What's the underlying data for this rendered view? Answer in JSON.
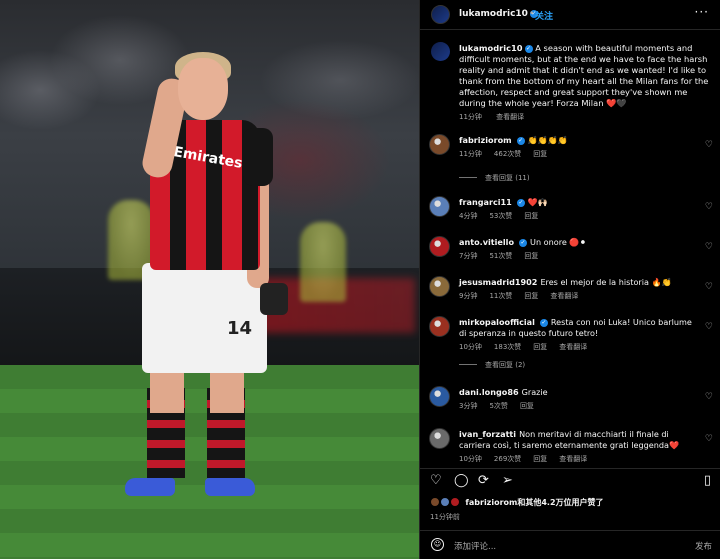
{
  "header": {
    "username": "lukamodric10",
    "separator": "•",
    "follow_label": "关注",
    "more_label": "···"
  },
  "caption": {
    "username": "lukamodric10",
    "text": "A season with beautiful moments and difficult moments, but at the end we have to face the harsh reality and admit that it didn't end as we wanted! I'd like to thank from the bottom of my heart all the Milan fans for the affection, respect and great support they've shown me during the whole year! Forza Milan ❤️🖤",
    "time": "11分钟",
    "translate_label": "查看翻译"
  },
  "comments": [
    {
      "username": "fabriziorom",
      "verified": true,
      "text": "👏👏👏👏",
      "time": "11分钟",
      "likes": "462次赞",
      "reply": "回复",
      "translate": "",
      "view_replies": "查看回复 (11)",
      "avatar_color": "#7a4a2a"
    },
    {
      "username": "frangarci11",
      "verified": true,
      "text": "❤️🙌🏻",
      "time": "4分钟",
      "likes": "53次赞",
      "reply": "回复",
      "translate": "",
      "view_replies": "",
      "avatar_color": "#5a7fb8"
    },
    {
      "username": "anto.vitiello",
      "verified": true,
      "text": "Un onore 🔴⚫",
      "time": "7分钟",
      "likes": "51次赞",
      "reply": "回复",
      "translate": "",
      "view_replies": "",
      "avatar_color": "#b01c20"
    },
    {
      "username": "jesusmadrid1902",
      "verified": false,
      "text": "Eres el mejor de la historia 🔥👏",
      "time": "9分钟",
      "likes": "11次赞",
      "reply": "回复",
      "translate": "查看翻译",
      "view_replies": "",
      "avatar_color": "#8a6a3a"
    },
    {
      "username": "mirkopaloofficial",
      "verified": true,
      "text": "Resta con noi Luka! Unico barlume di speranza in questo futuro tetro!",
      "time": "10分钟",
      "likes": "183次赞",
      "reply": "回复",
      "translate": "查看翻译",
      "view_replies": "查看回复 (2)",
      "avatar_color": "#9a3020"
    },
    {
      "username": "dani.longo86",
      "verified": false,
      "text": "Grazie",
      "time": "3分钟",
      "likes": "5次赞",
      "reply": "回复",
      "translate": "",
      "view_replies": "",
      "avatar_color": "#2a5aa0"
    },
    {
      "username": "ivan_forzatti",
      "verified": false,
      "text": "Non meritavi di macchiarti il finale di carriera così, ti saremo eternamente grati leggenda❤️",
      "time": "10分钟",
      "likes": "269次赞",
      "reply": "回复",
      "translate": "查看翻译",
      "view_replies": "",
      "avatar_color": "#6a6a6a"
    }
  ],
  "actions": {
    "like_icon": "heart-icon",
    "comment_icon": "comment-icon",
    "share_icon": "share-icon",
    "send_icon": "send-icon",
    "save_icon": "bookmark-icon"
  },
  "likes_summary": {
    "username": "fabriziorom",
    "text": "fabriziorom和其他4.2万位用户赞了"
  },
  "post_time": "11分钟前",
  "add_comment": {
    "placeholder": "添加评论...",
    "post_label": "发布"
  },
  "photo": {
    "shirt_sponsor": "Emirates FLY BETTER",
    "shirt_number": "14"
  },
  "colors": {
    "accent": "#2aa1f7",
    "verified": "#1b87e6",
    "background": "#000000",
    "muted_text": "#a8a8a8"
  }
}
